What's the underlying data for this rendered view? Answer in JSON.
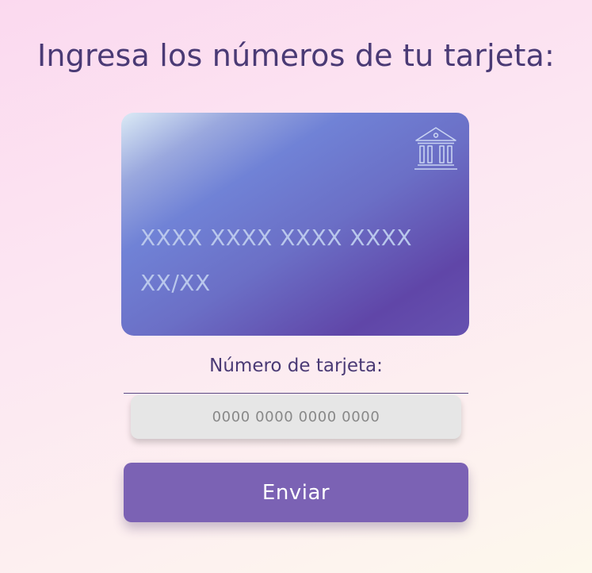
{
  "page": {
    "title": "Ingresa los números de tu tarjeta:"
  },
  "card_preview": {
    "number_placeholder": "XXXX XXXX XXXX XXXX",
    "expiry_placeholder": "XX/XX",
    "icon": "bank-icon"
  },
  "form": {
    "card_number_label": "Número de tarjeta:",
    "card_number_placeholder": "0000 0000 0000 0000",
    "card_number_value": "",
    "submit_label": "Enviar"
  },
  "colors": {
    "title_text": "#4a3a75",
    "button_background": "#7b62b4",
    "card_gradient_light": "#dbeaf5",
    "card_gradient_mid": "#7082d6",
    "card_gradient_dark": "#6046a8",
    "input_background": "#e6e6e6"
  }
}
